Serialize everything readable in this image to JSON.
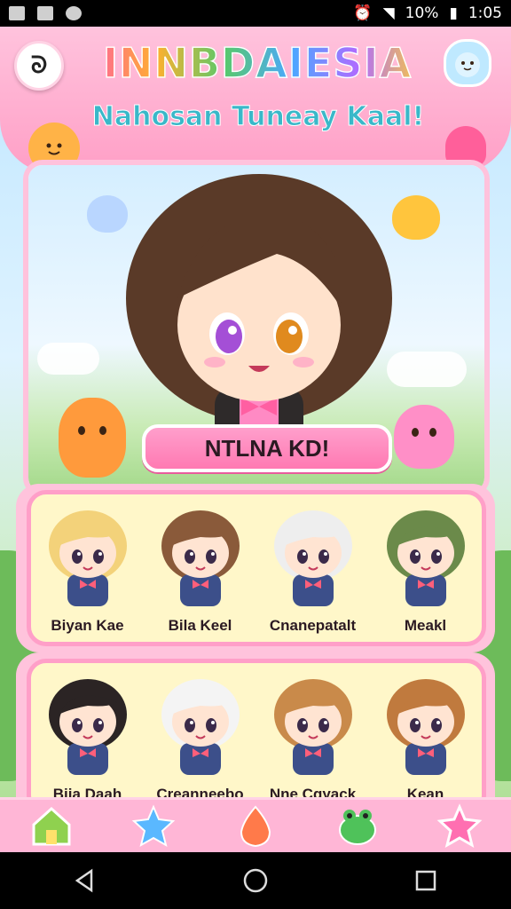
{
  "status_bar": {
    "battery": "10%",
    "time": "1:05"
  },
  "header": {
    "back_label": "ᘐ",
    "title": "INNBDAIESIA",
    "subtitle": "Nahosan Tuneay Kaal!"
  },
  "hero": {
    "button_label": "NTLNA KD!"
  },
  "panel_one": [
    {
      "name": "Biyan Kae",
      "hair": "#f3d27a"
    },
    {
      "name": "Bila Keel",
      "hair": "#8a5a3a"
    },
    {
      "name": "Cnanepatalt",
      "hair": "#eeeeee"
    },
    {
      "name": "Meakl",
      "hair": "#6b8a4a"
    }
  ],
  "panel_two": [
    {
      "name": "Bija Daah",
      "hair": "#2b2424"
    },
    {
      "name": "Creanneebo",
      "hair": "#f4f4f4"
    },
    {
      "name": "Nne Cgyack",
      "hair": "#c98a4a"
    },
    {
      "name": "Kean",
      "hair": "#c07a3e"
    }
  ],
  "bottom_nav": [
    {
      "icon": "house-icon",
      "color": "#8fd14f"
    },
    {
      "icon": "star-mascot-icon",
      "color": "#5ab8ff"
    },
    {
      "icon": "fire-mascot-icon",
      "color": "#ff7a4a"
    },
    {
      "icon": "frog-mascot-icon",
      "color": "#4fc25a"
    },
    {
      "icon": "star-icon",
      "color": "#ff6fb1"
    }
  ],
  "colors": {
    "accent_pink": "#ff79b2",
    "panel_bg": "#fff7c9",
    "frame_pink": "#ff9fc8"
  }
}
